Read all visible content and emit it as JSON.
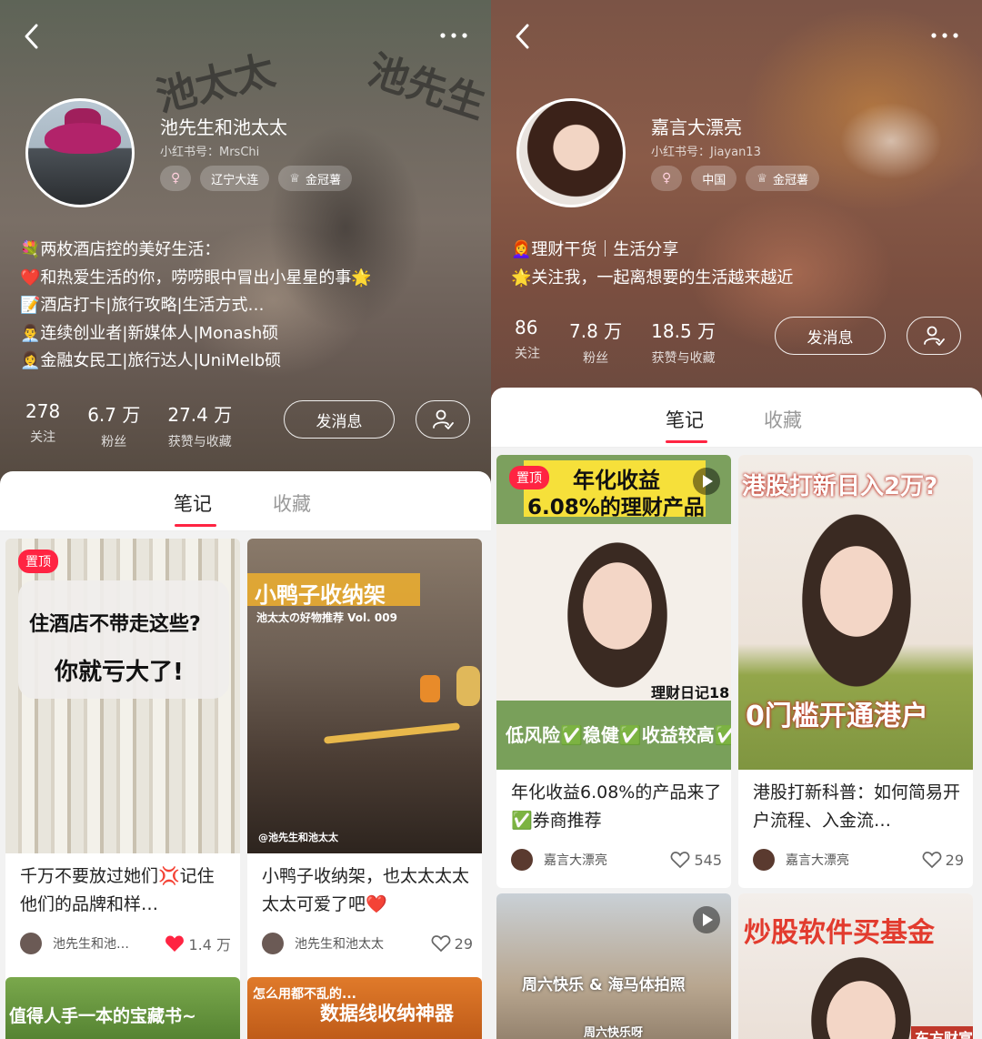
{
  "left": {
    "profile": {
      "name": "池先生和池太太",
      "red_id": "小红书号：MrsChi",
      "tag_gender": "♀",
      "tag_location": "辽宁大连",
      "tag_badge": "金冠薯",
      "bio": [
        "💐两枚酒店控的美好生活：",
        "❤️和热爱生活的你，唠唠眼中冒出小星星的事🌟",
        "📝酒店打卡|旅行攻略|生活方式…",
        "👨‍💼连续创业者|新媒体人|Monash硕",
        "👩‍💼金融女民工|旅行达人|UniMelb硕"
      ],
      "stats": [
        {
          "num": "278",
          "label": "关注"
        },
        {
          "num": "6.7 万",
          "label": "粉丝"
        },
        {
          "num": "27.4 万",
          "label": "获赞与收藏"
        }
      ],
      "message_button": "发消息",
      "bg_text_1": "池太太",
      "bg_text_2": "池先生"
    },
    "tabs": [
      "笔记",
      "收藏"
    ],
    "notes": [
      {
        "pinned": "置顶",
        "overlay_1": "住酒店不带走这些?",
        "overlay_2": "你就亏大了!",
        "title": "千万不要放过她们💢记住他们的品牌和样…",
        "author": "池先生和池…",
        "likes": "1.4 万",
        "liked": true
      },
      {
        "overlay_1": "小鸭子收纳架",
        "overlay_2": "池太太の好物推荐 Vol. 009",
        "overlay_3": "@池先生和池太太",
        "title": "小鸭子收纳架，也太太太太太太可爱了吧❤️",
        "author": "池先生和池太太",
        "likes": "29",
        "liked": false
      },
      {
        "overlay_1": "值得人手一本的宝藏书~"
      },
      {
        "overlay_1": "怎么用都不乱的...",
        "overlay_2": "数据线收纳神器"
      }
    ]
  },
  "right": {
    "profile": {
      "name": "嘉言大漂亮",
      "red_id": "小红书号：Jiayan13",
      "tag_gender": "♀",
      "tag_location": "中国",
      "tag_badge": "金冠薯",
      "bio": [
        "👩‍🦰理财干货｜生活分享",
        "🌟关注我，一起离想要的生活越来越近"
      ],
      "stats": [
        {
          "num": "86",
          "label": "关注"
        },
        {
          "num": "7.8 万",
          "label": "粉丝"
        },
        {
          "num": "18.5 万",
          "label": "获赞与收藏"
        }
      ],
      "message_button": "发消息"
    },
    "tabs": [
      "笔记",
      "收藏"
    ],
    "notes": [
      {
        "pinned": "置顶",
        "overlay_1": "年化收益",
        "overlay_2": "6.08%的理财产品",
        "overlay_3": "理财日记18",
        "overlay_4": "低风险✅稳健✅收益较高✅",
        "title": "年化收益6.08%的产品来了✅券商推荐",
        "author": "嘉言大漂亮",
        "likes": "545",
        "liked": false
      },
      {
        "overlay_1": "港股打新日入2万?",
        "overlay_2": "0门槛开通港户",
        "title": "港股打新科普：如何简易开户流程、入金流…",
        "author": "嘉言大漂亮",
        "likes": "29",
        "liked": false
      },
      {
        "overlay_1": "周六快乐 & 海马体拍照",
        "overlay_2": "周六快乐呀"
      },
      {
        "overlay_1": "炒股软件买基金",
        "overlay_2": "东方财富"
      }
    ]
  }
}
